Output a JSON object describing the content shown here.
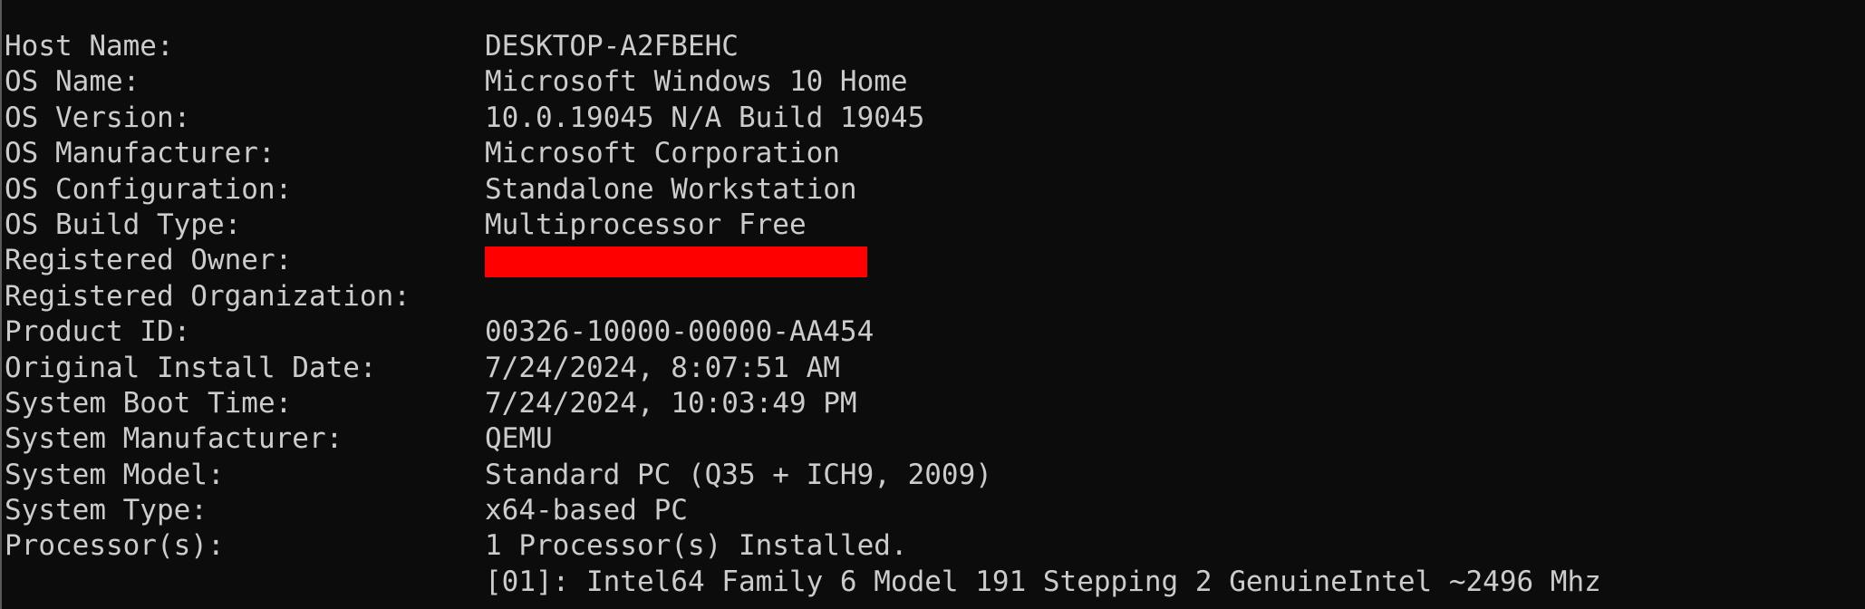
{
  "lines": [
    {
      "label": "Host Name:",
      "value": "DESKTOP-A2FBEHC"
    },
    {
      "label": "OS Name:",
      "value": "Microsoft Windows 10 Home"
    },
    {
      "label": "OS Version:",
      "value": "10.0.19045 N/A Build 19045"
    },
    {
      "label": "OS Manufacturer:",
      "value": "Microsoft Corporation"
    },
    {
      "label": "OS Configuration:",
      "value": "Standalone Workstation"
    },
    {
      "label": "OS Build Type:",
      "value": "Multiprocessor Free"
    },
    {
      "label": "Registered Owner:",
      "value": ""
    },
    {
      "label": "Registered Organization:",
      "value": ""
    },
    {
      "label": "Product ID:",
      "value": "00326-10000-00000-AA454"
    },
    {
      "label": "Original Install Date:",
      "value": "7/24/2024, 8:07:51 AM"
    },
    {
      "label": "System Boot Time:",
      "value": "7/24/2024, 10:03:49 PM"
    },
    {
      "label": "System Manufacturer:",
      "value": "QEMU"
    },
    {
      "label": "System Model:",
      "value": "Standard PC (Q35 + ICH9, 2009)"
    },
    {
      "label": "System Type:",
      "value": "x64-based PC"
    },
    {
      "label": "Processor(s):",
      "value": "1 Processor(s) Installed."
    },
    {
      "label": "",
      "value": "[01]: Intel64 Family 6 Model 191 Stepping 2 GenuineIntel ~2496 Mhz"
    }
  ],
  "colors": {
    "background": "#0c0c0c",
    "text": "#cccccc",
    "redaction": "#ff0000"
  }
}
